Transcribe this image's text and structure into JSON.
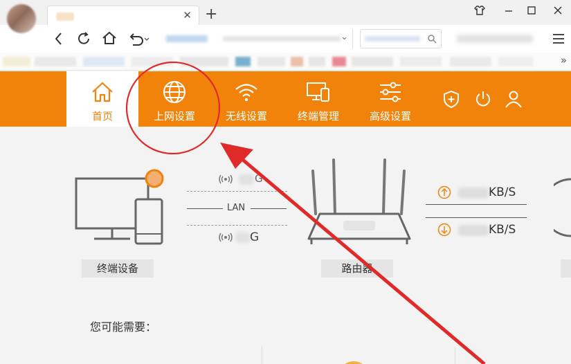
{
  "browser": {
    "new_tab": "+",
    "more_bookmarks": "»"
  },
  "nav": {
    "items": [
      {
        "label": "首页",
        "icon": "home-icon",
        "active": true
      },
      {
        "label": "上网设置",
        "icon": "globe-icon",
        "active": false
      },
      {
        "label": "无线设置",
        "icon": "wifi-icon",
        "active": false
      },
      {
        "label": "终端管理",
        "icon": "devices-icon",
        "active": false
      },
      {
        "label": "高级设置",
        "icon": "sliders-icon",
        "active": false
      }
    ]
  },
  "status": {
    "terminal_label": "终端设备",
    "router_label": "路由器",
    "lan": "LAN",
    "band_5g_suffix": "G",
    "band_24g_suffix": "G",
    "upload_unit": "KB/S",
    "download_unit": "KB/S"
  },
  "suggestions": {
    "title": "您可能需要："
  },
  "colors": {
    "brand": "#f1830a",
    "annotation": "#e02a2a"
  }
}
